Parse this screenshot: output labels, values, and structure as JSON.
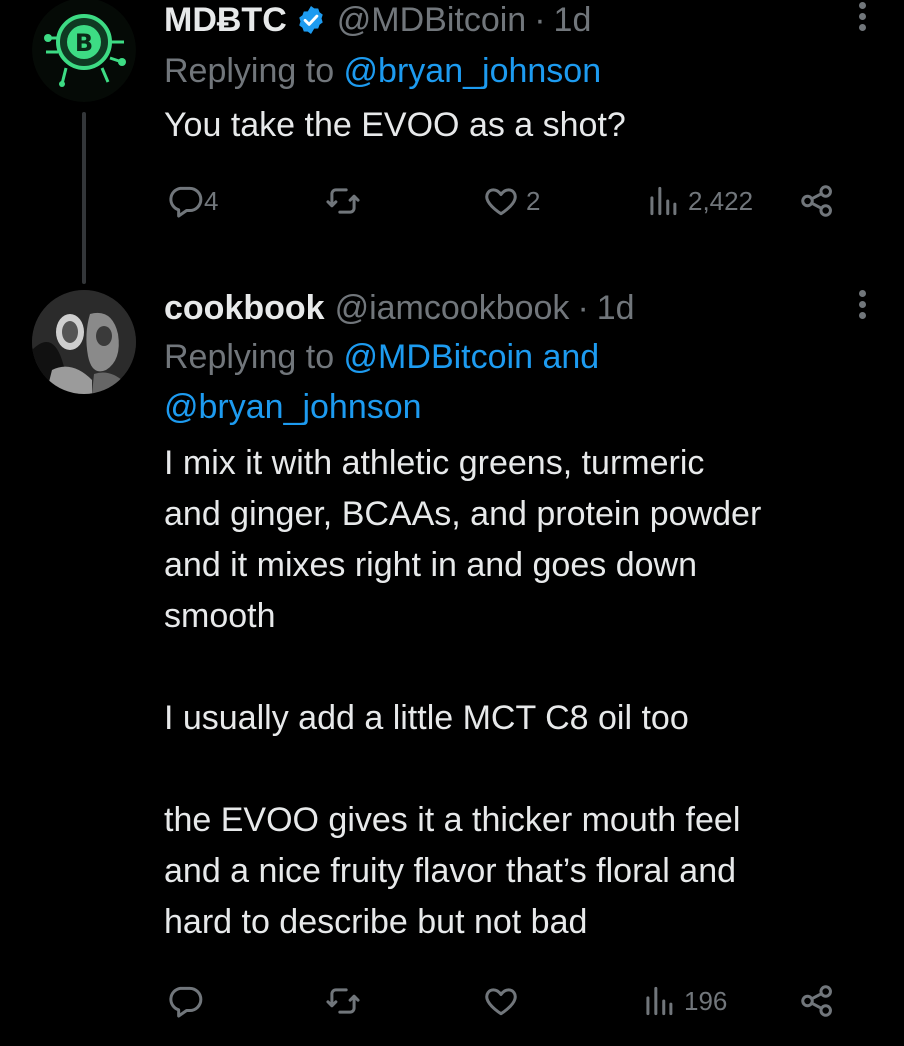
{
  "tweets": [
    {
      "name": "MDɃTC",
      "handle": "@MDBitcoin",
      "dot": "·",
      "time": "1d",
      "replying_prefix": "Replying to ",
      "replying_mentions": [
        "@bryan_johnson"
      ],
      "text": "You take the EVOO as a shot?",
      "verified": true,
      "actions": {
        "reply": "4",
        "retweet": "",
        "like": "2",
        "views": "2,422"
      },
      "icons": {
        "reply": "reply-icon",
        "retweet": "retweet-icon",
        "like": "heart-icon",
        "views": "views-icon",
        "share": "share-icon",
        "more": "more-icon"
      }
    },
    {
      "name": "cookbook",
      "handle": "@iamcookbook",
      "dot": "·",
      "time": "1d",
      "replying_prefix": "Replying to ",
      "replying_mentions": [
        "@MDBitcoin",
        "and",
        "@bryan_johnson"
      ],
      "text": "I mix it with athletic greens, turmeric\nand ginger, BCAAs, and protein powder\nand it mixes right in and goes down\nsmooth\n\nI usually add a little MCT C8 oil too\n\nthe EVOO gives it a thicker mouth feel\nand a nice fruity flavor that’s floral and\nhard to describe but not bad",
      "verified": false,
      "actions": {
        "reply": "",
        "retweet": "",
        "like": "",
        "views": "196"
      }
    }
  ],
  "colors": {
    "background": "#000000",
    "text": "#e7e9ea",
    "muted": "#71767b",
    "link": "#1d9bf0",
    "verified": "#1d9bf0",
    "avatar_accent": "#3ddc84"
  }
}
